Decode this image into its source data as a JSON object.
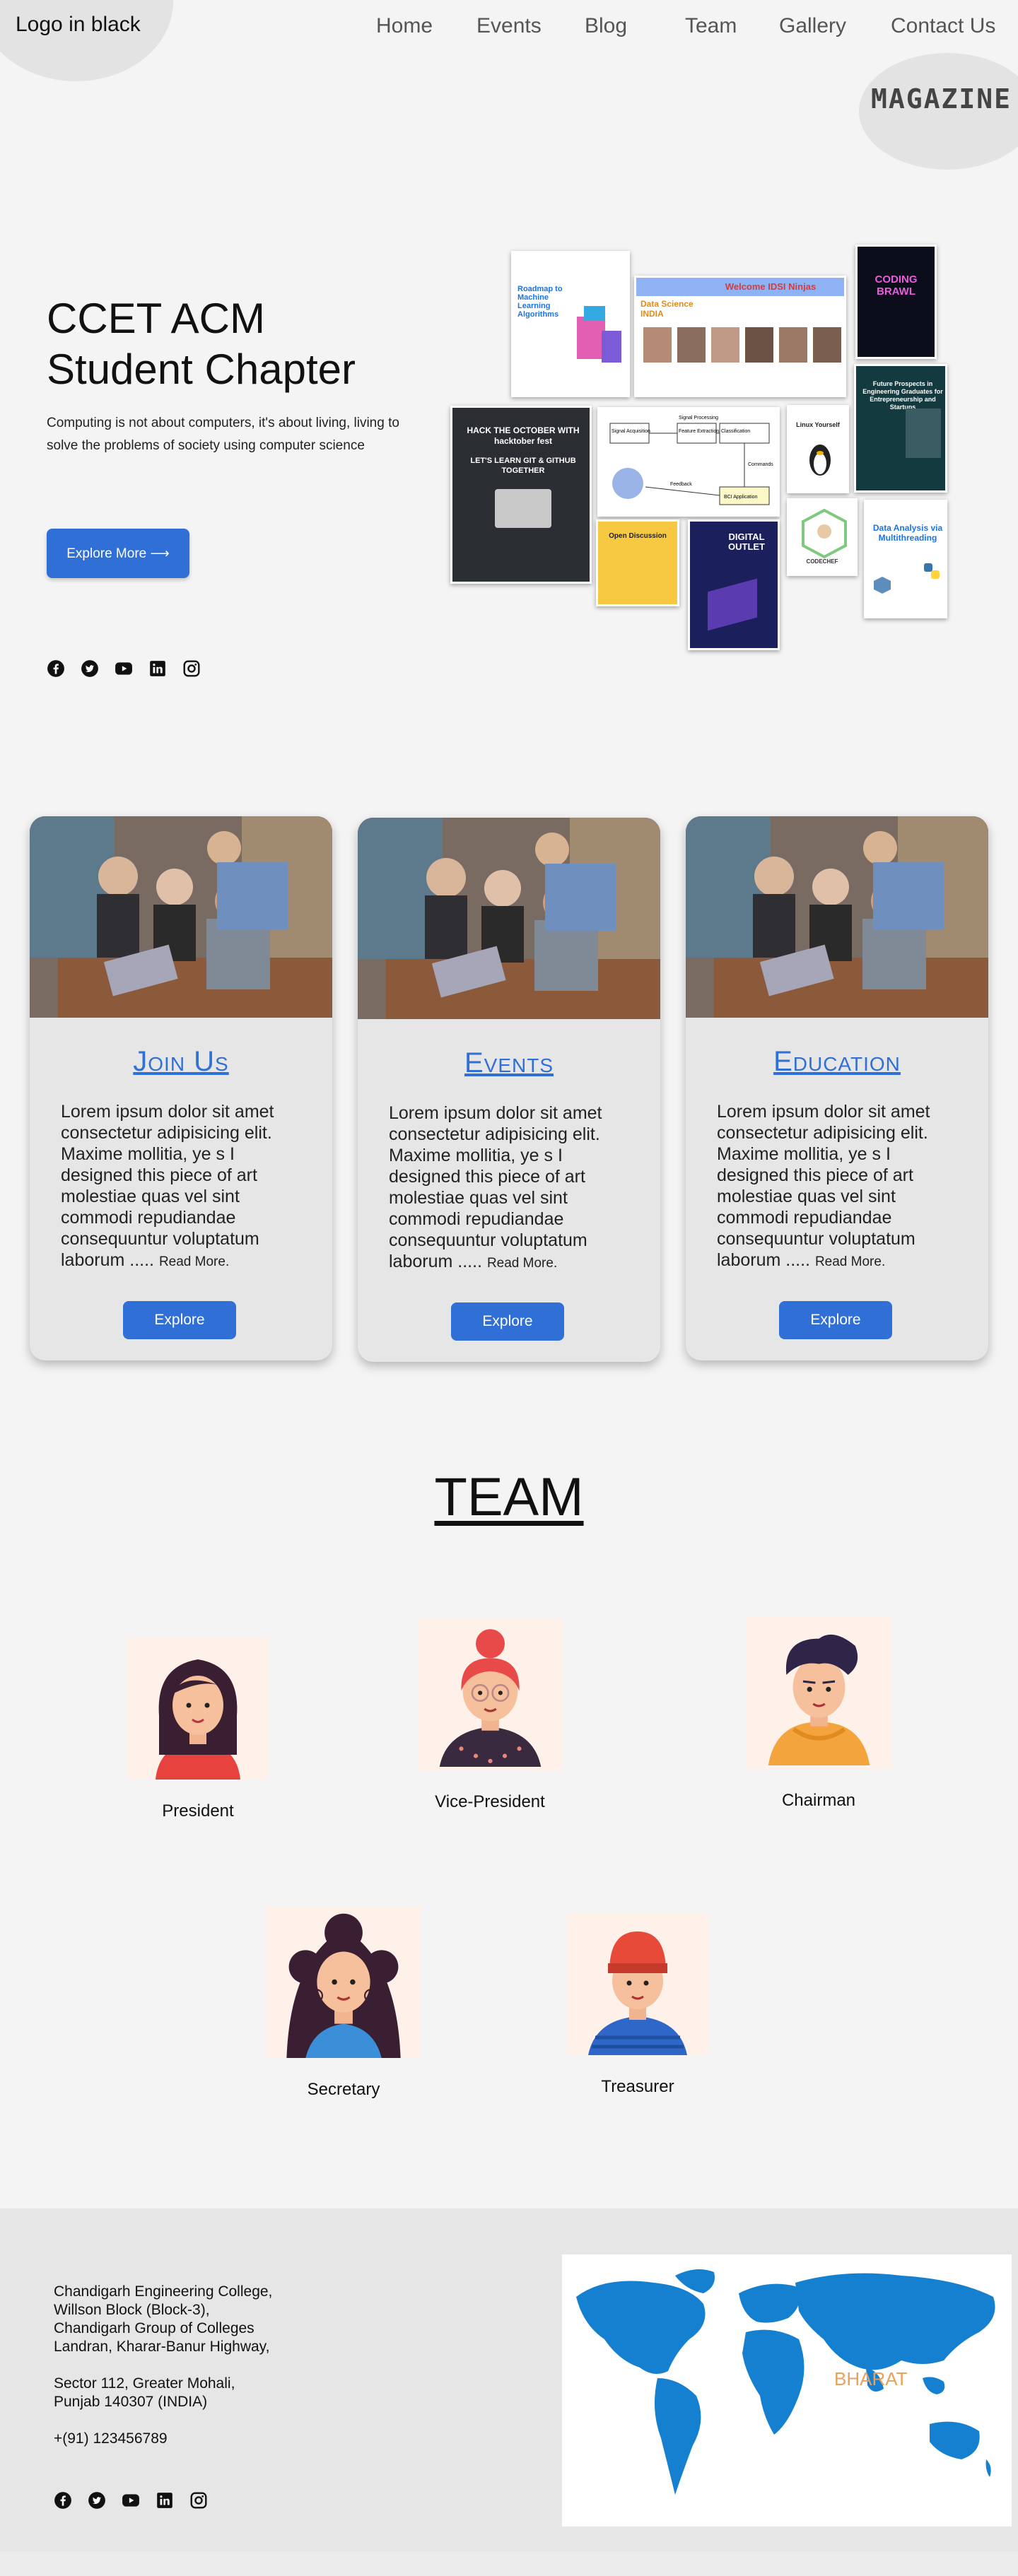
{
  "nav": {
    "logo": "Logo in black",
    "links": [
      "Home",
      "Events",
      "Blog",
      "Team",
      "Gallery",
      "Contact Us"
    ],
    "magazine": "MAGAZINE"
  },
  "hero": {
    "title_line1": "CCET ACM",
    "title_line2": "Student Chapter",
    "description": "Computing is not about computers, it's about living, living to solve the problems of society using computer science",
    "button": "Explore More ⟶",
    "socials": [
      "facebook-icon",
      "twitter-icon",
      "youtube-icon",
      "linkedin-icon",
      "instagram-icon"
    ]
  },
  "collage": {
    "p1": "Roadmap to Machine Learning Algorithms",
    "p2_title": "Data Science INDIA",
    "p2_banner": "Welcome IDSI Ninjas",
    "p3": "CODING BRAWL",
    "p4_line1": "HACK THE OCTOBER WITH hacktober fest",
    "p4_line2": "LET'S LEARN GIT & GITHUB TOGETHER",
    "p5_a": "Signal Acquisition",
    "p5_b": "Signal Processing",
    "p5_c": "Feature Extraction",
    "p5_d": "Classification",
    "p5_e": "Feedback",
    "p5_f": "BCI Application",
    "p5_g": "Commands",
    "p6": "Linux Yourself",
    "p7": "Future Prospects in Engineering Graduates for Entrepreneurship and Startups",
    "p8": "Open Discussion",
    "p9_title": "DIGITAL OUTLET",
    "p10": "CODECHEF",
    "p11": "Data Analysis via Multithreading"
  },
  "cards": [
    {
      "title": "Join Us",
      "body": "Lorem ipsum dolor sit amet consectetur adipisicing elit. Maxime mollitia, ye s I designed this piece of art molestiae quas vel sint commodi repudiandae consequuntur voluptatum laborum .....",
      "read_more": "Read More.",
      "button": "Explore"
    },
    {
      "title": "Events",
      "body": "Lorem ipsum dolor sit amet consectetur adipisicing elit. Maxime mollitia, ye s I designed this piece of art molestiae quas vel sint commodi repudiandae consequuntur voluptatum laborum .....",
      "read_more": "Read More.",
      "button": "Explore"
    },
    {
      "title": "Education",
      "body": "Lorem ipsum dolor sit amet consectetur adipisicing elit. Maxime mollitia, ye s I designed this piece of art molestiae quas vel sint commodi repudiandae consequuntur voluptatum laborum .....",
      "read_more": "Read More.",
      "button": "Explore"
    }
  ],
  "team": {
    "title": "TEAM",
    "members": [
      {
        "role": "President"
      },
      {
        "role": "Vice-President"
      },
      {
        "role": "Chairman"
      },
      {
        "role": "Secretary"
      },
      {
        "role": "Treasurer"
      }
    ]
  },
  "footer": {
    "address_lines": [
      "Chandigarh Engineering College,",
      "Willson Block (Block-3),",
      "Chandigarh Group of Colleges",
      "Landran, Kharar-Banur Highway,"
    ],
    "address_lines2": [
      "Sector 112, Greater Mohali,",
      "Punjab 140307 (INDIA)"
    ],
    "phone": "+(91) 123456789",
    "map_label": "BHARAT"
  },
  "colors": {
    "accent": "#2f6fd6",
    "background": "#f4f4f4",
    "card": "#e6e6e6",
    "map": "#1580d0",
    "map_label": "#e8a25c"
  }
}
